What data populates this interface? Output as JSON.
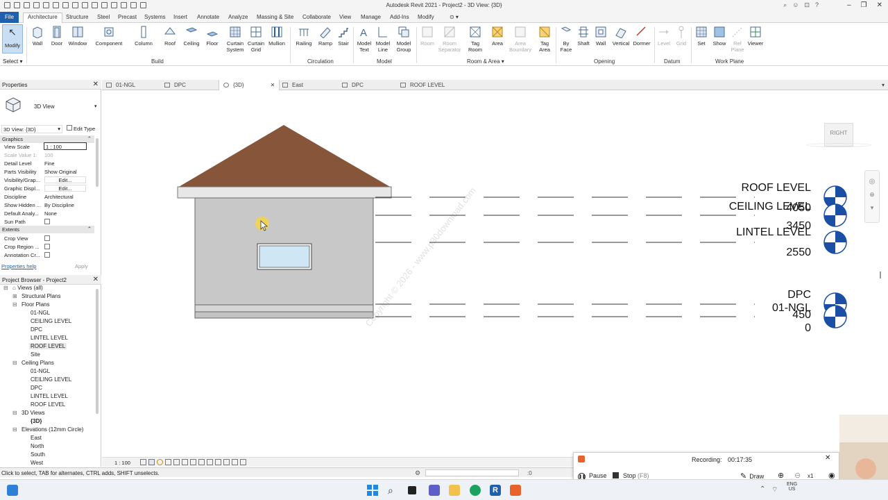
{
  "app": {
    "title": "Autodesk Revit 2021 - Project2 - 3D View: {3D}"
  },
  "menu": {
    "tabs": [
      "File",
      "Architecture",
      "Structure",
      "Steel",
      "Precast",
      "Systems",
      "Insert",
      "Annotate",
      "Analyze",
      "Massing & Site",
      "Collaborate",
      "View",
      "Manage",
      "Add-Ins",
      "Modify"
    ]
  },
  "ribbon": {
    "modify": "Modify",
    "select": "Select",
    "build": {
      "label": "Build",
      "buttons": [
        "Wall",
        "Door",
        "Window",
        "Component",
        "Column",
        "Roof",
        "Ceiling",
        "Floor",
        "Curtain System",
        "Curtain Grid",
        "Mullion"
      ]
    },
    "circulation": {
      "label": "Circulation",
      "buttons": [
        "Railing",
        "Ramp",
        "Stair"
      ]
    },
    "model": {
      "label": "Model",
      "buttons": [
        "Model Text",
        "Model Line",
        "Model Group"
      ]
    },
    "room_area": {
      "label": "Room & Area",
      "buttons": [
        "Room",
        "Room Separator",
        "Tag Room",
        "Area",
        "Area Boundary",
        "Tag Area"
      ]
    },
    "opening": {
      "label": "Opening",
      "buttons": [
        "By Face",
        "Shaft",
        "Wall",
        "Vertical",
        "Dormer"
      ]
    },
    "datum": {
      "label": "Datum",
      "buttons": [
        "Level",
        "Grid"
      ]
    },
    "work_plane": {
      "label": "Work Plane",
      "buttons": [
        "Set",
        "Show",
        "Ref Plane",
        "Viewer"
      ]
    }
  },
  "doc_tabs": [
    "01-NGL",
    "DPC",
    "{3D}",
    "East",
    "DPC",
    "ROOF LEVEL"
  ],
  "properties": {
    "title": "Properties",
    "type_name": "3D View",
    "selector": "3D View: {3D}",
    "edit_type": "Edit Type",
    "group_graphics": "Graphics",
    "group_extents": "Extents",
    "rows": [
      {
        "k": "View Scale",
        "v": "1 : 100"
      },
      {
        "k": "Scale Value    1:",
        "v": "100"
      },
      {
        "k": "Detail Level",
        "v": "Fine"
      },
      {
        "k": "Parts Visibility",
        "v": "Show Original"
      },
      {
        "k": "Visibility/Grap...",
        "v": "Edit..."
      },
      {
        "k": "Graphic Displ...",
        "v": "Edit..."
      },
      {
        "k": "Discipline",
        "v": "Architectural"
      },
      {
        "k": "Show Hidden ...",
        "v": "By Discipline"
      },
      {
        "k": "Default Analy...",
        "v": "None"
      },
      {
        "k": "Sun Path",
        "v": ""
      }
    ],
    "extents_rows": [
      {
        "k": "Crop View"
      },
      {
        "k": "Crop Region ..."
      },
      {
        "k": "Annotation Cr..."
      }
    ],
    "help": "Properties help",
    "apply": "Apply"
  },
  "browser": {
    "title": "Project Browser - Project2",
    "items": [
      "Views (all)",
      "Structural Plans",
      "Floor Plans",
      "01-NGL",
      "CEILING LEVEL",
      "DPC",
      "LINTEL LEVEL",
      "ROOF LEVEL",
      "Site",
      "Ceiling Plans",
      "01-NGL",
      "CEILING LEVEL",
      "DPC",
      "LINTEL LEVEL",
      "ROOF LEVEL",
      "3D Views",
      "{3D}",
      "Elevations (12mm Circle)",
      "East",
      "North",
      "South",
      "West"
    ]
  },
  "levels": [
    {
      "name": "ROOF LEVEL",
      "elev": "4050"
    },
    {
      "name": "CEILING LEVEL",
      "elev": "3450"
    },
    {
      "name": "LINTEL LEVEL",
      "elev": "2550"
    },
    {
      "name": "DPC",
      "elev": "450"
    },
    {
      "name": "01-NGL",
      "elev": "0"
    }
  ],
  "viewcube": {
    "face": "RIGHT"
  },
  "viewbar": {
    "scale": "1 : 100"
  },
  "status": {
    "hint": "Click to select, TAB for alternates, CTRL adds, SHIFT unselects.",
    "filter": ":0"
  },
  "recording": {
    "label": "Recording:",
    "time": "00:17:35",
    "pause": "Pause",
    "stop": "Stop",
    "stop_key": "(F8)",
    "draw": "Draw",
    "zoom": "x1"
  },
  "taskbar": {
    "lang": "ENG",
    "region": "US"
  },
  "watermark": "Copyright © 2026 - www.p30download.com",
  "colors": {
    "accent": "#1f5fad",
    "roof": "#86553a",
    "wall": "#c8c8c8",
    "window": "#cfe6f5",
    "level_head": "#1a4fa5"
  }
}
